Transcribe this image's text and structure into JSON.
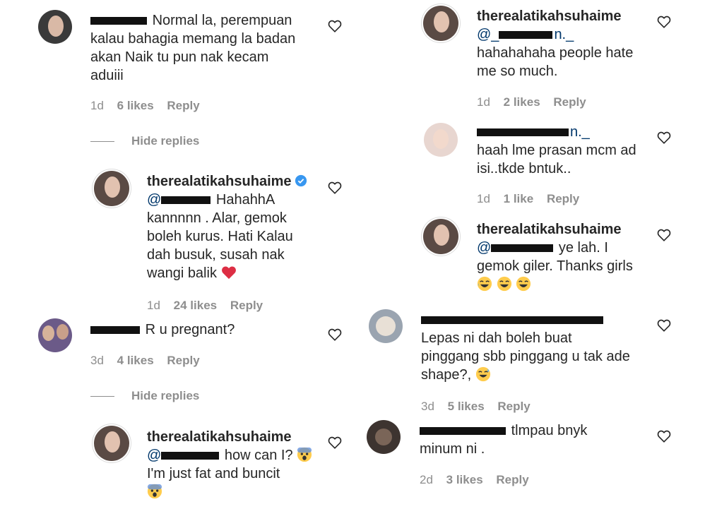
{
  "left": {
    "c1": {
      "text": "Normal la, perempuan kalau bahagia memang la badan akan Naik tu pun nak kecam aduiii",
      "line1": "Normal la, perempuan",
      "line2": "kalau bahagia memang la badan",
      "line3": "akan Naik tu pun nak kecam",
      "line4": "aduiii",
      "time": "1d",
      "likes": "6 likes",
      "reply": "Reply"
    },
    "hide1": "Hide replies",
    "r1": {
      "user": "therealatikahsuhaime",
      "mention": "@",
      "line1": "HahahhA",
      "line2": "kannnnn . Alar, gemok",
      "line3": "boleh kurus. Hati Kalau",
      "line4": "dah busuk, susah nak",
      "line5": "wangi balik",
      "time": "1d",
      "likes": "24 likes",
      "reply": "Reply"
    },
    "c2": {
      "text": "R u pregnant?",
      "time": "3d",
      "likes": "4 likes",
      "reply": "Reply"
    },
    "hide2": "Hide replies",
    "r2": {
      "user": "therealatikahsuhaime",
      "mention": "@",
      "line1": "how can I?",
      "line2": "I'm just fat and buncit"
    }
  },
  "right": {
    "r1": {
      "user": "therealatikahsuhaime",
      "mention": "@_",
      "mention_end": "n._",
      "line1": "hahahahaha people hate",
      "line2": "me so much.",
      "time": "1d",
      "likes": "2 likes",
      "reply": "Reply"
    },
    "r2": {
      "mention_end": "n._",
      "line1": "haah lme prasan mcm ad",
      "line2": "isi..tkde bntuk..",
      "time": "1d",
      "likes": "1 like",
      "reply": "Reply"
    },
    "r3": {
      "user": "therealatikahsuhaime",
      "mention": "@",
      "after": "ye lah. I",
      "line2": "gemok giler. Thanks girls",
      "time": "",
      "likes": "",
      "reply": ""
    },
    "c1": {
      "line1": "Lepas ni dah boleh buat",
      "line2": "pinggang sbb pinggang u tak ade",
      "line3": "shape?,",
      "time": "3d",
      "likes": "5 likes",
      "reply": "Reply"
    },
    "c2": {
      "after": "tlmpau bnyk",
      "line2": "minum ni .",
      "time": "2d",
      "likes": "3 likes",
      "reply": "Reply"
    }
  },
  "colors": {
    "text": "#262626",
    "muted": "#8e8e8e",
    "link": "#00376b",
    "verified": "#3897f0",
    "heart_red": "#ed4956"
  },
  "icons": [
    "heart-outline-icon",
    "verified-badge-icon",
    "red-heart-emoji",
    "laughing-emoji",
    "fearful-emoji",
    "sweat-smile-emoji"
  ]
}
